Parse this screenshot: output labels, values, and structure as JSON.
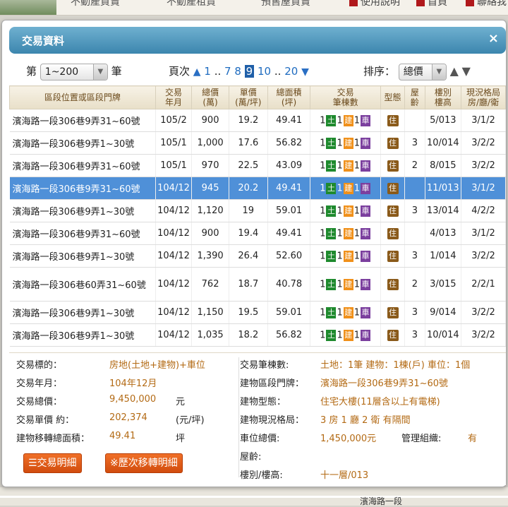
{
  "topbar": {
    "tabs": [
      "不動產買賣",
      "不動產租賃",
      "預售屋買賣"
    ],
    "help": "使用說明",
    "home": "首頁",
    "contact": "聯絡我"
  },
  "dialog": {
    "title": "交易資料",
    "close": "×"
  },
  "controls": {
    "range_prefix": "第",
    "range_value": "1~200",
    "range_suffix": "筆",
    "page_label": "頁次",
    "pages_a": "1",
    "sep1": "..",
    "pages_b": [
      "7",
      "8"
    ],
    "page_current": "9",
    "pages_c": "10",
    "sep2": "..",
    "pages_d": "20",
    "sort_label": "排序：",
    "sort_value": "總價"
  },
  "table": {
    "headers": [
      "區段位置或區段門牌",
      "交易\n年月",
      "總價\n(萬)",
      "單價\n(萬/坪)",
      "總面積\n(坪)",
      "交易\n筆棟數",
      "型態",
      "屋\n齡",
      "樓別\n樓高",
      "現況格局\n房/廳/衛"
    ],
    "rows": [
      {
        "addr": "濱海路一段306巷9弄31~60號",
        "ym": "105/2",
        "total": "900",
        "unit": "19.2",
        "area": "49.41",
        "age": "",
        "floor": "5/013",
        "layout": "3/1/2"
      },
      {
        "addr": "濱海路一段306巷9弄1~30號",
        "ym": "105/1",
        "total": "1,000",
        "unit": "17.6",
        "area": "56.82",
        "age": "3",
        "floor": "10/014",
        "layout": "3/2/2"
      },
      {
        "addr": "濱海路一段306巷9弄31~60號",
        "ym": "105/1",
        "total": "970",
        "unit": "22.5",
        "area": "43.09",
        "age": "2",
        "floor": "8/015",
        "layout": "3/2/2"
      },
      {
        "addr": "濱海路一段306巷9弄31~60號",
        "ym": "104/12",
        "total": "945",
        "unit": "20.2",
        "area": "49.41",
        "age": "",
        "floor": "11/013",
        "layout": "3/1/2"
      },
      {
        "addr": "濱海路一段306巷9弄1~30號",
        "ym": "104/12",
        "total": "1,120",
        "unit": "19",
        "area": "59.01",
        "age": "3",
        "floor": "13/014",
        "layout": "4/2/2"
      },
      {
        "addr": "濱海路一段306巷9弄31~60號",
        "ym": "104/12",
        "total": "900",
        "unit": "19.4",
        "area": "49.41",
        "age": "",
        "floor": "4/013",
        "layout": "3/1/2"
      },
      {
        "addr": "濱海路一段306巷9弄1~30號",
        "ym": "104/12",
        "total": "1,390",
        "unit": "26.4",
        "area": "52.60",
        "age": "3",
        "floor": "1/014",
        "layout": "3/2/2"
      },
      {
        "addr": "濱海路一段306巷60弄31~60號",
        "ym": "104/12",
        "total": "762",
        "unit": "18.7",
        "area": "40.78",
        "age": "2",
        "floor": "3/015",
        "layout": "2/2/1"
      },
      {
        "addr": "濱海路一段306巷9弄1~30號",
        "ym": "104/12",
        "total": "1,150",
        "unit": "19.5",
        "area": "59.01",
        "age": "3",
        "floor": "9/014",
        "layout": "3/2/2"
      },
      {
        "addr": "濱海路一段306巷9弄1~30號",
        "ym": "104/12",
        "total": "1,035",
        "unit": "18.2",
        "area": "56.82",
        "age": "3",
        "floor": "10/014",
        "layout": "3/2/2"
      }
    ],
    "badges": {
      "one": "1",
      "land": "土",
      "bldg": "建",
      "car": "車",
      "type": "住"
    }
  },
  "detail": {
    "l_target": "交易標的：",
    "v_target": "房地(土地+建物)+車位",
    "l_ym": "交易年月：",
    "v_ym": "104年12月",
    "l_total": "交易總價：",
    "v_total": "9,450,000",
    "u_total": "元",
    "l_unit": "交易單價 約：",
    "v_unit": "202,374",
    "u_unit": "(元/坪)",
    "l_area": "建物移轉總面積：",
    "v_area": "49.41",
    "u_area": "坪",
    "l_count": "交易筆棟數:",
    "v_count": "土地：1筆 建物：1棟(戶) 車位：1個",
    "l_addr": "建物區段門牌：",
    "v_addr": "濱海路一段306巷9弄31~60號",
    "l_type": "建物型態：",
    "v_type": "住宅大樓(11層含以上有電梯)",
    "l_layout": "建物現況格局：",
    "v_layout": "3 房 1 廳 2 衛 有隔間",
    "l_car": "車位總價:",
    "v_car": "1,450,000元",
    "l_mgmt": "管理組織:",
    "v_mgmt": "有",
    "l_age": "屋齡:",
    "l_floor": "樓別/樓高:",
    "v_floor": "十一層/013",
    "btn_detail": "☰交易明細",
    "btn_history": "※歷次移轉明細"
  },
  "map": {
    "road": "濱海路一段"
  }
}
